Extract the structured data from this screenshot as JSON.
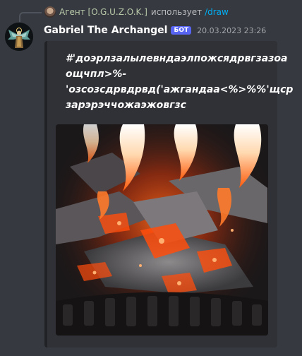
{
  "reply": {
    "username": "Агент [O.G.U.Z.O.K.]",
    "action_text": "использует",
    "command": "/draw"
  },
  "message": {
    "username": "Gabriel The Archangel",
    "badge": "БОТ",
    "timestamp": "20.03.2023 23:26"
  },
  "embed": {
    "prompt_lines": [
      "#'доэрлзалылевндаэлпожсядрвгзазоа",
      "ощчпл>%-",
      "'озсозсдрвдрвд('ажгандаа<%>%%'щср",
      "зарэрэччожаэжовгзс"
    ]
  },
  "colors": {
    "background": "#36393f",
    "embed_bg": "#2f3136",
    "badge": "#5865f2",
    "command_link": "#00aff4"
  },
  "icons": {
    "reply_avatar": "user-avatar-icon",
    "bot_avatar": "archangel-avatar-icon",
    "image": "fire-embers-image"
  }
}
